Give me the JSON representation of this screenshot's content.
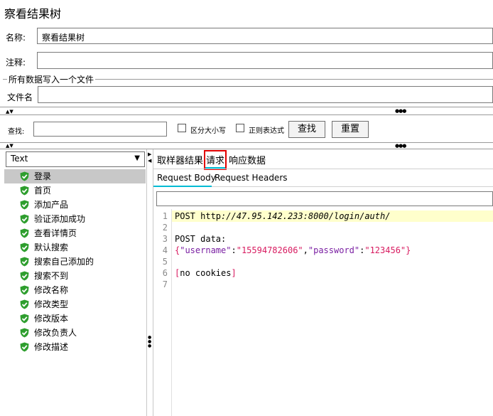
{
  "window_title": "察看结果树",
  "form": {
    "name_label": "名称:",
    "name_value": "察看结果树",
    "comment_label": "注释:",
    "comment_value": "",
    "group_title": "所有数据写入一个文件",
    "filename_label": "文件名",
    "filename_value": ""
  },
  "search": {
    "label": "查找:",
    "value": "",
    "case_label": "区分大小写",
    "regex_label": "正则表达式",
    "find_button": "查找",
    "reset_button": "重置"
  },
  "render_select": {
    "selected": "Text"
  },
  "tree": {
    "items": [
      {
        "label": "登录",
        "status": "success"
      },
      {
        "label": "首页",
        "status": "success"
      },
      {
        "label": "添加产品",
        "status": "success"
      },
      {
        "label": "验证添加成功",
        "status": "success"
      },
      {
        "label": "查看详情页",
        "status": "success"
      },
      {
        "label": "默认搜索",
        "status": "success"
      },
      {
        "label": "搜索自己添加的",
        "status": "success"
      },
      {
        "label": "搜索不到",
        "status": "success"
      },
      {
        "label": "修改名称",
        "status": "success"
      },
      {
        "label": "修改类型",
        "status": "success"
      },
      {
        "label": "修改版本",
        "status": "success"
      },
      {
        "label": "修改负责人",
        "status": "success"
      },
      {
        "label": "修改描述",
        "status": "success"
      }
    ],
    "selected_index": 0
  },
  "tabs": {
    "sampler_result": "取样器结果",
    "request": "请求",
    "response_data": "响应数据",
    "active": "请求"
  },
  "subtabs": {
    "request_body": "Request Body",
    "request_headers": "Request Headers",
    "active": "Request Body"
  },
  "code": {
    "lines": [
      "1",
      "2",
      "3",
      "4",
      "5",
      "6",
      "7"
    ],
    "l1_method": "POST ",
    "l1_scheme": "http",
    "l1_url": "://47.95.142.233:8000/login/auth/",
    "l3": "POST data:",
    "l4_k1": "\"username\"",
    "l4_v1": "\"15594782606\"",
    "l4_k2": "\"password\"",
    "l4_v2": "\"123456\"",
    "l6": "no cookies"
  },
  "colors": {
    "highlight_line": "#ffffcc",
    "json_key": "#7a1fa2",
    "json_string": "#d81b60",
    "brace": "#d81b60",
    "active_tab_border": "#e00000",
    "active_tab_underline": "#00bcd4",
    "success_icon": "#2e9e2e"
  }
}
